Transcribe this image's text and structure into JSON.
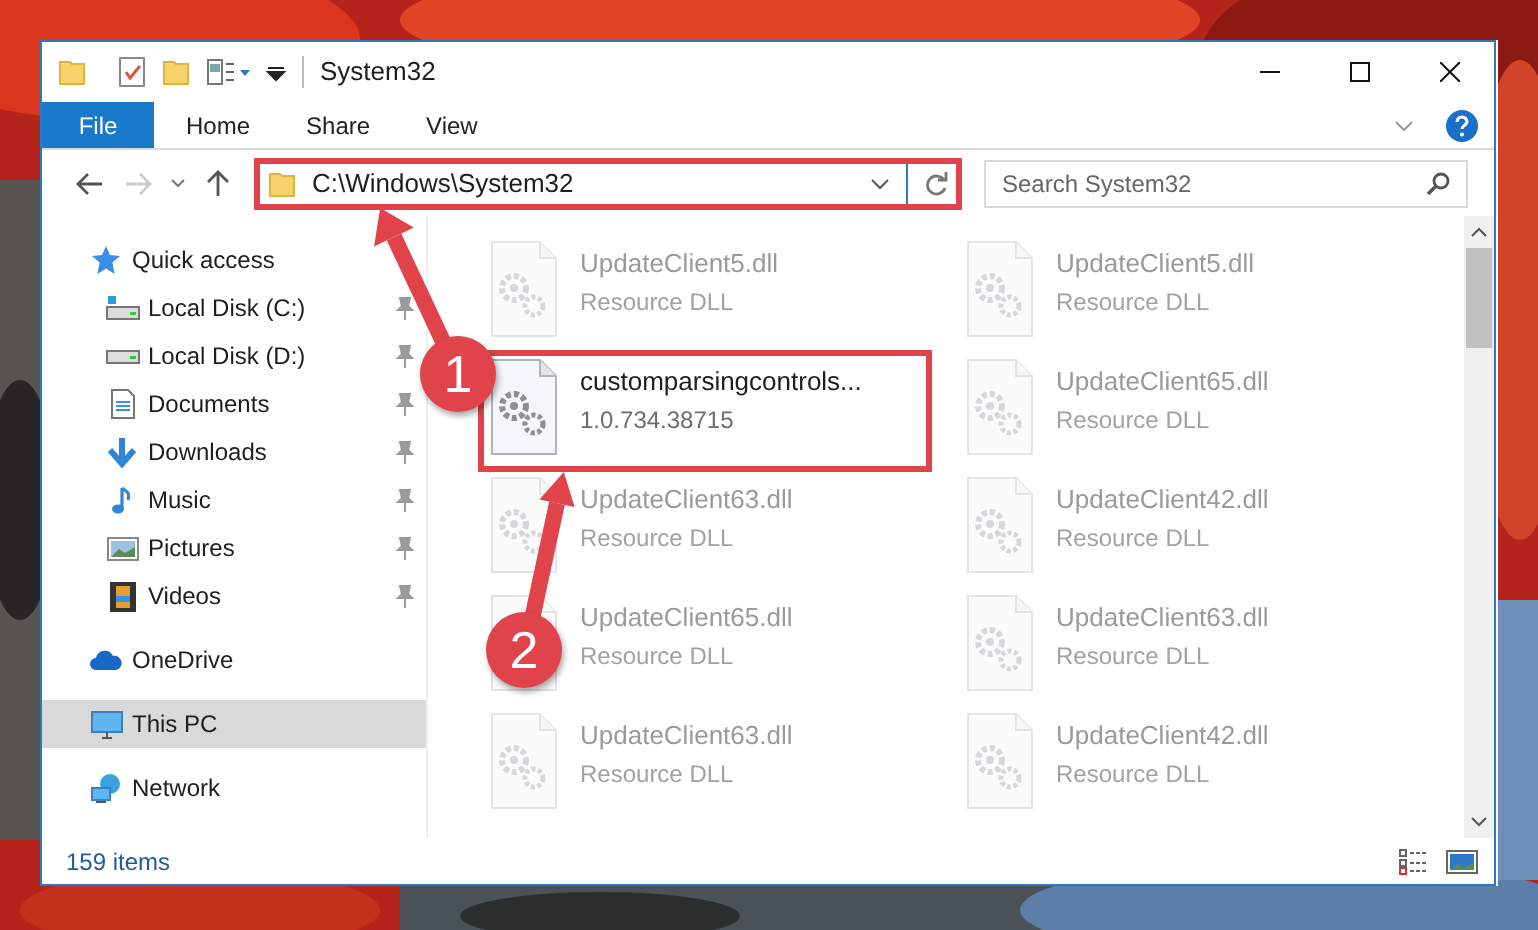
{
  "window": {
    "title": "System32"
  },
  "ribbon": {
    "tabs": [
      {
        "label": "File",
        "kind": "file",
        "selected": false
      },
      {
        "label": "Home",
        "kind": "tab",
        "selected": false
      },
      {
        "label": "Share",
        "kind": "tab",
        "selected": false
      },
      {
        "label": "View",
        "kind": "tab",
        "selected": false
      }
    ]
  },
  "address_bar": {
    "path": "C:\\Windows\\System32",
    "highlighted": true
  },
  "search": {
    "placeholder": "Search System32"
  },
  "navigation": [
    {
      "label": "Quick access",
      "kind": "star",
      "selected": false,
      "children": [
        {
          "label": "Local Disk (C:)",
          "kind": "drive-c",
          "selected": false,
          "pinned": true
        },
        {
          "label": "Local Disk (D:)",
          "kind": "drive",
          "selected": false,
          "pinned": true
        },
        {
          "label": "Documents",
          "kind": "documents",
          "selected": false,
          "pinned": true
        },
        {
          "label": "Downloads",
          "kind": "downloads",
          "selected": false,
          "pinned": true
        },
        {
          "label": "Music",
          "kind": "music",
          "selected": false,
          "pinned": true
        },
        {
          "label": "Pictures",
          "kind": "pictures",
          "selected": false,
          "pinned": true
        },
        {
          "label": "Videos",
          "kind": "videos",
          "selected": false,
          "pinned": true
        }
      ]
    },
    {
      "label": "OneDrive",
      "kind": "cloud",
      "selected": false
    },
    {
      "label": "This PC",
      "kind": "computer",
      "selected": true
    },
    {
      "label": "Network",
      "kind": "network",
      "selected": false
    }
  ],
  "files": [
    {
      "name": "UpdateClient5.dll",
      "detail": "Resource DLL",
      "faded": true,
      "highlighted": false
    },
    {
      "name": "UpdateClient5.dll",
      "detail": "Resource DLL",
      "faded": true,
      "highlighted": false
    },
    {
      "name": "customparsingcontrols...",
      "detail": "1.0.734.38715",
      "faded": false,
      "highlighted": true
    },
    {
      "name": "UpdateClient65.dll",
      "detail": "Resource DLL",
      "faded": true,
      "highlighted": false
    },
    {
      "name": "UpdateClient63.dll",
      "detail": "Resource DLL",
      "faded": true,
      "highlighted": false
    },
    {
      "name": "UpdateClient42.dll",
      "detail": "Resource DLL",
      "faded": true,
      "highlighted": false
    },
    {
      "name": "UpdateClient65.dll",
      "detail": "Resource DLL",
      "faded": true,
      "highlighted": false
    },
    {
      "name": "UpdateClient63.dll",
      "detail": "Resource DLL",
      "faded": true,
      "highlighted": false
    },
    {
      "name": "UpdateClient63.dll",
      "detail": "Resource DLL",
      "faded": true,
      "highlighted": false
    },
    {
      "name": "UpdateClient42.dll",
      "detail": "Resource DLL",
      "faded": true,
      "highlighted": false
    }
  ],
  "status_bar": {
    "item_count": "159 items"
  },
  "callouts": [
    {
      "number": "1"
    },
    {
      "number": "2"
    }
  ]
}
